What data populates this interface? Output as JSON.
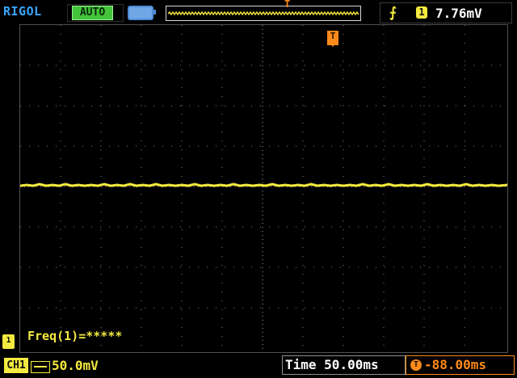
{
  "header": {
    "brand": "RIGOL",
    "mode": "AUTO",
    "trigger_marker": "T",
    "trigger_edge": "rising",
    "trigger_channel": "1",
    "trigger_level": "7.76mV"
  },
  "screen": {
    "trigger_marker": "T",
    "frequency_readout": "Freq(1)=*****",
    "channel_marker": "1"
  },
  "footer": {
    "channel": "CH1",
    "vertical_scale": "50.0mV",
    "time_label": "Time",
    "time_scale": "50.00ms",
    "trigger_offset": "-88.00ms"
  },
  "colors": {
    "channel1": "#f4ea3f",
    "trigger": "#ff8a1a",
    "brand": "#37a7ff",
    "grid": "#8c8c8c"
  }
}
